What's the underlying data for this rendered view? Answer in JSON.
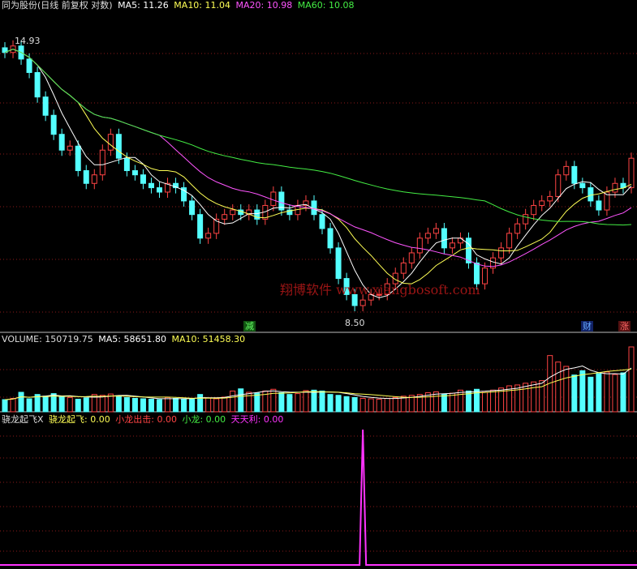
{
  "main_panel": {
    "stock_title": "同为股份(日线 前复权 对数)",
    "ma_labels": [
      {
        "label": "MA5: 11.26",
        "color": "#ffffff"
      },
      {
        "label": "MA10: 11.04",
        "color": "#ffff55"
      },
      {
        "label": "MA20: 10.98",
        "color": "#ff55ff"
      },
      {
        "label": "MA60: 10.08",
        "color": "#44ee44"
      }
    ],
    "high_label": "14.93",
    "low_label": "8.50",
    "watermark": "翔博软件 www.xiangbosoft.com",
    "event_tags": {
      "reduce": "减",
      "finance": "财",
      "limit_up": "涨"
    }
  },
  "volume_panel": {
    "title": "VOLUME: 150719.75",
    "ma5_label": "MA5: 58651.80",
    "ma10_label": "MA10: 51458.30"
  },
  "indicator_panel": {
    "name": "骁龙起飞X",
    "items": [
      {
        "label": "骁龙起飞: 0.00",
        "color": "#ffff55"
      },
      {
        "label": "小龙出击: 0.00",
        "color": "#ff4444"
      },
      {
        "label": "小龙: 0.00",
        "color": "#44ee44"
      },
      {
        "label": "天天利: 0.00",
        "color": "#ff33ff"
      }
    ]
  },
  "colors": {
    "up": "#ff4444",
    "down": "#54ffff",
    "ma5": "#ffffff",
    "ma10": "#ffff55",
    "ma20": "#ff55ff",
    "ma60": "#44ee44",
    "grid": "#8b1a1a",
    "indicator": "#ff33ff"
  },
  "chart_data": {
    "type": "candlestick",
    "scale": "log",
    "ylim": [
      8.2,
      15.6
    ],
    "max_price": 14.93,
    "min_price": 8.5,
    "closes": [
      14.5,
      14.7,
      14.3,
      13.9,
      13.2,
      12.7,
      12.2,
      11.8,
      11.9,
      11.3,
      11.0,
      11.2,
      11.8,
      12.2,
      11.6,
      11.3,
      11.2,
      11.0,
      10.9,
      10.8,
      11.0,
      10.9,
      10.6,
      10.3,
      9.8,
      9.9,
      10.2,
      10.3,
      10.4,
      10.3,
      10.4,
      10.2,
      10.5,
      10.8,
      10.4,
      10.3,
      10.5,
      10.6,
      10.3,
      10.0,
      9.6,
      9.0,
      8.7,
      8.5,
      8.6,
      8.7,
      8.7,
      8.9,
      9.1,
      9.3,
      9.5,
      9.8,
      9.9,
      10.0,
      9.6,
      9.7,
      9.8,
      9.3,
      8.9,
      9.2,
      9.4,
      9.6,
      9.9,
      10.1,
      10.3,
      10.5,
      10.6,
      10.7,
      11.2,
      11.4,
      11.0,
      10.9,
      10.6,
      10.4,
      10.8,
      11.0,
      10.9,
      11.6
    ],
    "volumes": [
      28,
      31,
      45,
      30,
      40,
      36,
      42,
      35,
      33,
      29,
      32,
      40,
      38,
      41,
      37,
      33,
      31,
      30,
      29,
      28,
      33,
      31,
      30,
      29,
      40,
      32,
      30,
      34,
      48,
      53,
      45,
      43,
      48,
      52,
      44,
      40,
      42,
      49,
      50,
      48,
      40,
      38,
      35,
      33,
      31,
      30,
      29,
      31,
      33,
      36,
      38,
      40,
      44,
      46,
      41,
      43,
      50,
      48,
      52,
      45,
      50,
      55,
      60,
      62,
      66,
      69,
      72,
      130,
      115,
      105,
      85,
      95,
      80,
      88,
      92,
      86,
      90,
      150
    ],
    "volume_ma5": 58651.8,
    "volume_ma10": 51458.3,
    "volume_last": 150719.75,
    "indicator_signal_index": 44
  }
}
